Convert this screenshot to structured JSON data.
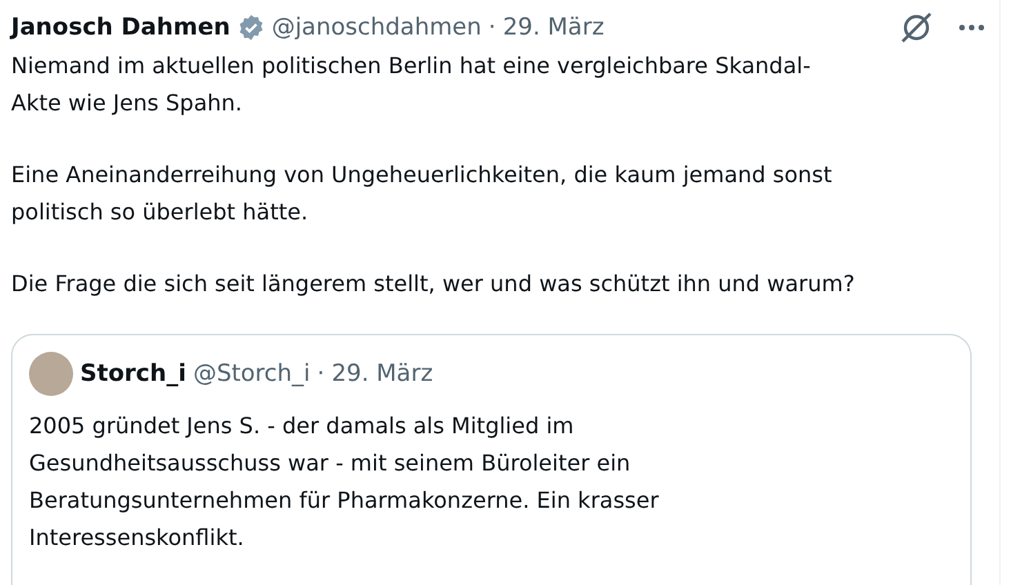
{
  "tweet": {
    "author": "Janosch Dahmen",
    "verified": true,
    "handle": "@janoschdahmen",
    "separator": "·",
    "date": "29. März",
    "paragraphs": [
      "Niemand im aktuellen politischen Berlin hat eine vergleichbare Skandal-Akte wie Jens Spahn.",
      "Eine Aneinanderreihung von Ungeheuerlichkeiten, die kaum jemand sonst politisch so überlebt hätte.",
      "Die Frage die sich seit längerem stellt, wer und was schützt ihn und warum?"
    ],
    "quote": {
      "author": "Storch_i",
      "handle": "@Storch_i",
      "separator": "·",
      "date": "29. März",
      "text": "2005 gründet Jens S. - der damals als Mitglied im Gesundheitsausschuss war - mit seinem Büroleiter ein Beratungsunternehmen für Pharmakonzerne. Ein krasser Interessenskonflikt."
    }
  }
}
